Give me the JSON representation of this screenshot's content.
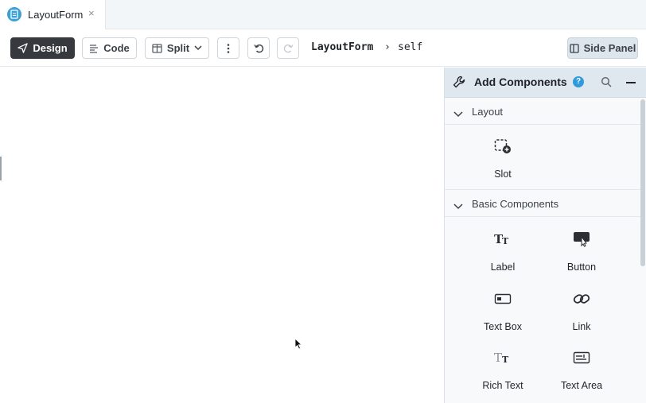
{
  "tab": {
    "title": "LayoutForm",
    "close": "×"
  },
  "toolbar": {
    "design_label": "Design",
    "code_label": "Code",
    "split_label": "Split",
    "breadcrumb": {
      "form": "LayoutForm",
      "separator": "›",
      "target": "self"
    },
    "side_panel_label": "Side Panel"
  },
  "panel": {
    "title": "Add Components",
    "help": "?",
    "sections": {
      "layout": {
        "label": "Layout",
        "items": [
          {
            "label": "Slot",
            "icon": "slot-icon"
          }
        ]
      },
      "basic": {
        "label": "Basic Components",
        "items": [
          {
            "label": "Label",
            "icon": "label-text-icon"
          },
          {
            "label": "Button",
            "icon": "button-pointer-icon"
          },
          {
            "label": "Text Box",
            "icon": "textbox-icon"
          },
          {
            "label": "Link",
            "icon": "link-icon"
          },
          {
            "label": "Rich Text",
            "icon": "rich-text-icon"
          },
          {
            "label": "Text Area",
            "icon": "text-area-icon"
          }
        ]
      }
    }
  },
  "colors": {
    "design_bg": "#363a3e",
    "accent": "#3aa1d8",
    "panel_header": "#dfe8ee",
    "help": "#2f9bdc"
  }
}
